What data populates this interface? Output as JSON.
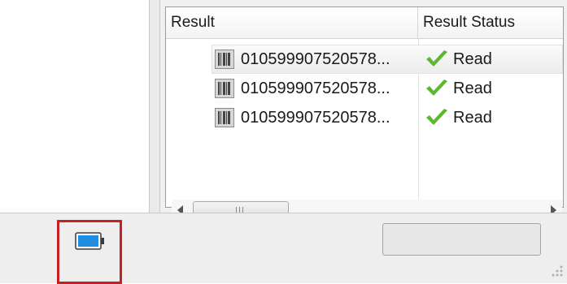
{
  "list": {
    "columns": {
      "result": "Result",
      "status": "Result Status"
    },
    "rows": [
      {
        "result": "010599907520578...",
        "status": "Read",
        "selected": true
      },
      {
        "result": "010599907520578...",
        "status": "Read",
        "selected": false
      },
      {
        "result": "010599907520578...",
        "status": "Read",
        "selected": false
      }
    ]
  },
  "icons": {
    "row_icon": "barcode-icon",
    "status_icon": "checkmark-icon",
    "statusbar_icon": "battery-icon"
  },
  "colors": {
    "checkmark": "#5cb82e",
    "battery_fill": "#1f8de0",
    "highlight_frame": "#c82020"
  }
}
